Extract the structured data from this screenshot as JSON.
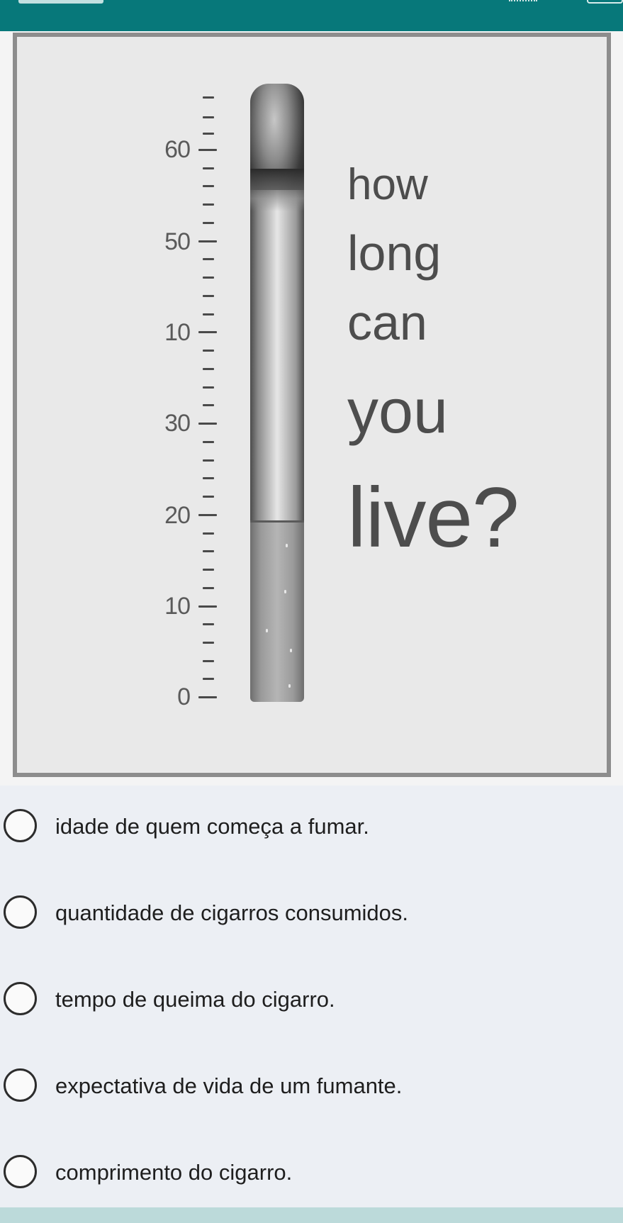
{
  "thermometer_scale": {
    "labels": [
      "60",
      "50",
      "10",
      "30",
      "20",
      "10",
      "0"
    ]
  },
  "headline": {
    "words": [
      "how",
      "long",
      "can",
      "you",
      "live?"
    ]
  },
  "question": {
    "options": [
      {
        "label": "idade de quem começa a fumar.",
        "selected": false
      },
      {
        "label": "quantidade de cigarros consumidos.",
        "selected": false
      },
      {
        "label": "tempo de queima do cigarro.",
        "selected": false
      },
      {
        "label": "expectativa de vida de um fumante.",
        "selected": false
      },
      {
        "label": "comprimento do cigarro.",
        "selected": false
      }
    ]
  },
  "colors": {
    "header": "#07787a",
    "background": "#eceff4",
    "figure_border": "#8d8d8d",
    "headline_text": "#4d4d4d"
  }
}
